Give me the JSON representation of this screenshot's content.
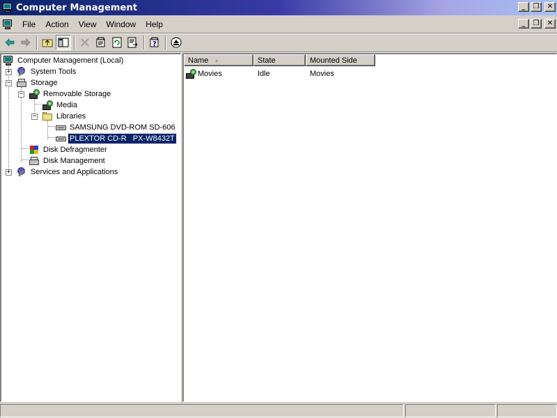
{
  "window": {
    "title": "Computer Management",
    "controls": {
      "minimize": "_",
      "restore": "❐",
      "close": "✕"
    }
  },
  "menu": {
    "items": [
      "File",
      "Action",
      "View",
      "Window",
      "Help"
    ]
  },
  "toolbar": {
    "buttons": [
      "back",
      "forward",
      "up-level",
      "show-hide-tree",
      "delete",
      "properties",
      "refresh",
      "export-list",
      "help",
      "eject"
    ]
  },
  "tree": {
    "root": "Computer Management (Local)",
    "system_tools": "System Tools",
    "storage": "Storage",
    "removable_storage": "Removable Storage",
    "media": "Media",
    "libraries": "Libraries",
    "samsung": "SAMSUNG DVD-ROM SD-606",
    "plextor": "PLEXTOR CD-R   PX-W8432T",
    "disk_defragmenter": "Disk Defragmenter",
    "disk_management": "Disk Management",
    "services": "Services and Applications",
    "expander_plus": "+",
    "expander_minus": "−"
  },
  "list": {
    "columns": [
      "Name",
      "State",
      "Mounted Side"
    ],
    "rows": [
      {
        "name": "Movies",
        "state": "Idle",
        "mounted_side": "Movies"
      }
    ]
  },
  "colors": {
    "title_gradient_start": "#0a246a",
    "title_gradient_end": "#a8c0f0",
    "selection": "#0a246a",
    "face": "#d4d0c8"
  }
}
